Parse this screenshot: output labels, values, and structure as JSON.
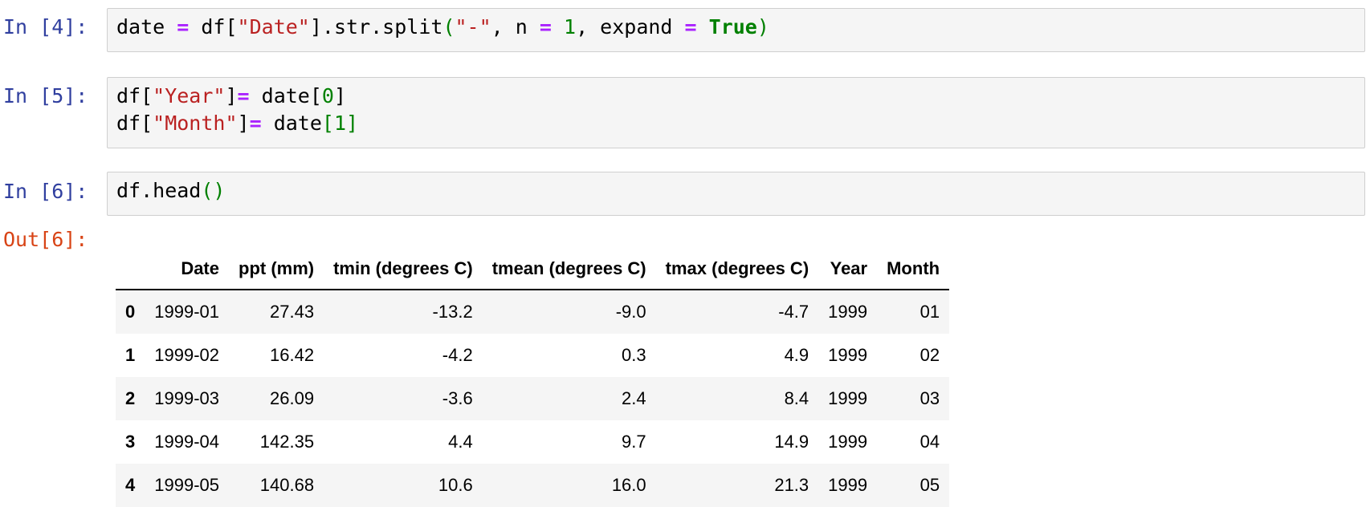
{
  "cells": [
    {
      "prompt": "In [4]:",
      "code": {
        "l1_a": "date ",
        "l1_op1": "=",
        "l1_b": " df[",
        "l1_s1": "\"Date\"",
        "l1_c": "].str.split",
        "l1_p1": "(",
        "l1_s2": "\"-\"",
        "l1_d": ", n ",
        "l1_op2": "=",
        "l1_e": " ",
        "l1_n1": "1",
        "l1_f": ", expand ",
        "l1_op3": "=",
        "l1_g": " ",
        "l1_kw": "True",
        "l1_p2": ")"
      }
    },
    {
      "prompt": "In [5]:",
      "code": {
        "l1_a": "df[",
        "l1_s": "\"Year\"",
        "l1_b": "]",
        "l1_op": "=",
        "l1_c": " date[",
        "l1_n": "0",
        "l1_d": "]",
        "l2_a": "df[",
        "l2_s": "\"Month\"",
        "l2_b": "]",
        "l2_op": "=",
        "l2_c": " date",
        "l2_n": "[1]"
      }
    },
    {
      "prompt": "In [6]:",
      "code": {
        "l1_a": "df.head",
        "l1_p": "()"
      },
      "out_prompt": "Out[6]:"
    }
  ],
  "table": {
    "columns": [
      "",
      "Date",
      "ppt (mm)",
      "tmin (degrees C)",
      "tmean (degrees C)",
      "tmax (degrees C)",
      "Year",
      "Month"
    ],
    "rows": [
      [
        "0",
        "1999-01",
        "27.43",
        "-13.2",
        "-9.0",
        "-4.7",
        "1999",
        "01"
      ],
      [
        "1",
        "1999-02",
        "16.42",
        "-4.2",
        "0.3",
        "4.9",
        "1999",
        "02"
      ],
      [
        "2",
        "1999-03",
        "26.09",
        "-3.6",
        "2.4",
        "8.4",
        "1999",
        "03"
      ],
      [
        "3",
        "1999-04",
        "142.35",
        "4.4",
        "9.7",
        "14.9",
        "1999",
        "04"
      ],
      [
        "4",
        "1999-05",
        "140.68",
        "10.6",
        "16.0",
        "21.3",
        "1999",
        "05"
      ]
    ]
  }
}
